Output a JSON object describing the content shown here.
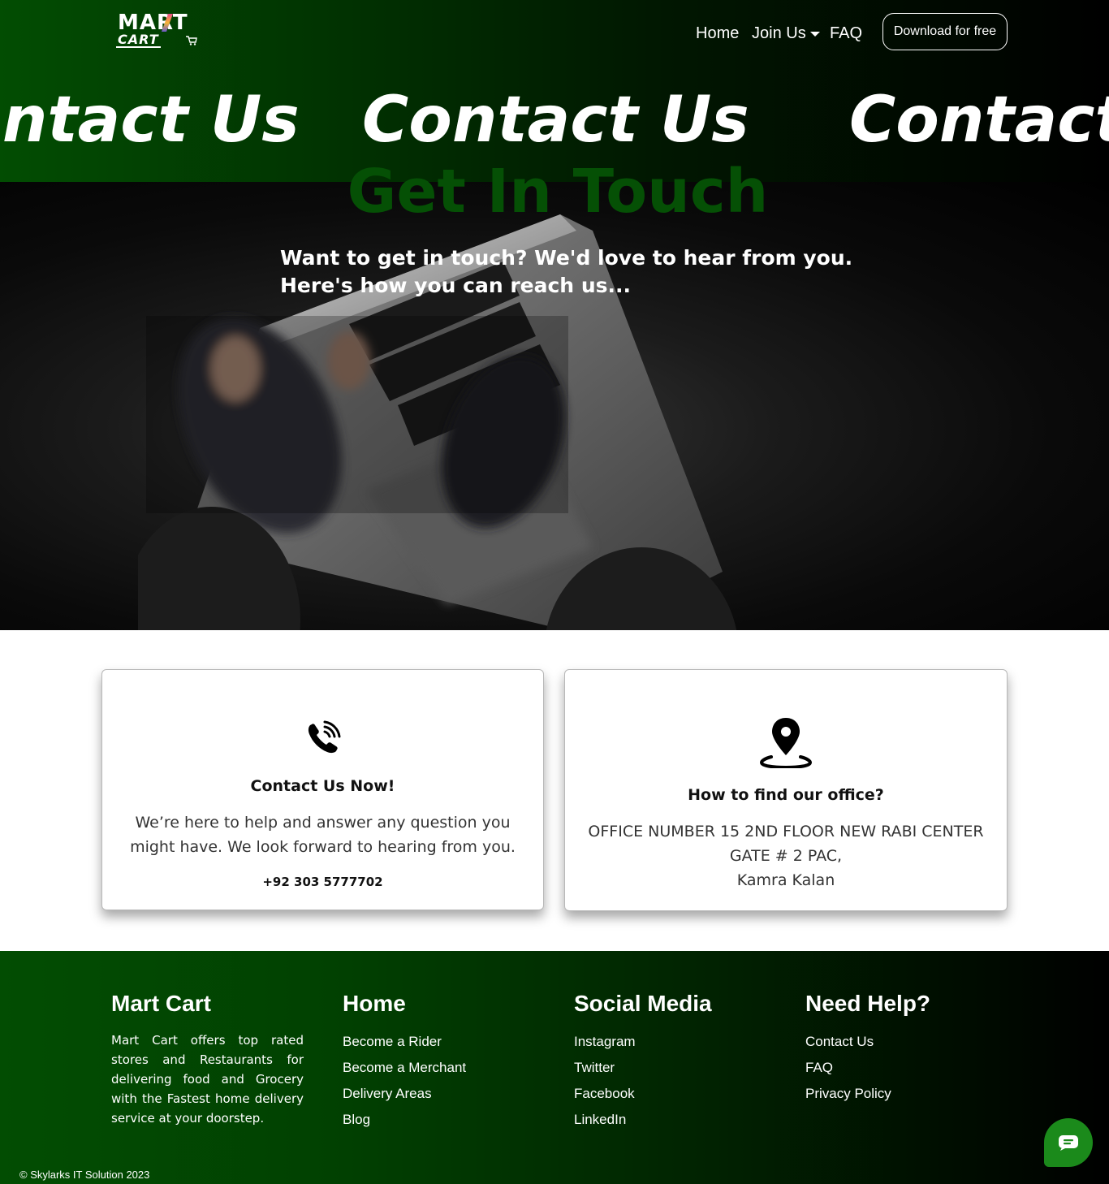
{
  "brand": {
    "logo_top": "MART",
    "logo_bottom": "CART"
  },
  "nav": {
    "home": "Home",
    "join_us": "Join Us",
    "faq": "FAQ",
    "download": "Download for free"
  },
  "banner": {
    "marquee": "Contact Us"
  },
  "hero": {
    "title": "Get In Touch",
    "subtitle_line1": "Want to get in touch? We'd love to hear from you.",
    "subtitle_line2": "Here's how you can reach us..."
  },
  "contact_card": {
    "title": "Contact Us Now!",
    "text": "We’re here to help and answer any question you might have. We look forward to hearing from you.",
    "phone": "+92 303 5777702"
  },
  "office_card": {
    "title": "How to find our office?",
    "address_line1": "OFFICE NUMBER 15 2ND FLOOR NEW RABI CENTER",
    "address_line2": "GATE # 2 PAC,",
    "address_line3": "Kamra Kalan"
  },
  "footer": {
    "about": {
      "heading": "Mart Cart",
      "text": "Mart Cart offers top rated stores and Restaurants for delivering food and Grocery with the Fastest home delivery service at your doorstep."
    },
    "home": {
      "heading": "Home",
      "links": [
        "Become a Rider",
        "Become a Merchant",
        "Delivery Areas",
        "Blog"
      ]
    },
    "social": {
      "heading": "Social Media",
      "links": [
        "Instagram",
        "Twitter",
        "Facebook",
        "LinkedIn"
      ]
    },
    "help": {
      "heading": "Need Help?",
      "links": [
        "Contact Us",
        "FAQ",
        "Privacy Policy"
      ]
    },
    "copyright": "© Skylarks IT Solution 2023"
  },
  "icons": {
    "phone": "phone-icon",
    "location": "location-pin-icon",
    "chat": "chat-icon",
    "caret": "caret-down-icon"
  },
  "colors": {
    "brand_green": "#055005",
    "header_green": "#024d02",
    "chat_green": "#1b8a1b"
  }
}
